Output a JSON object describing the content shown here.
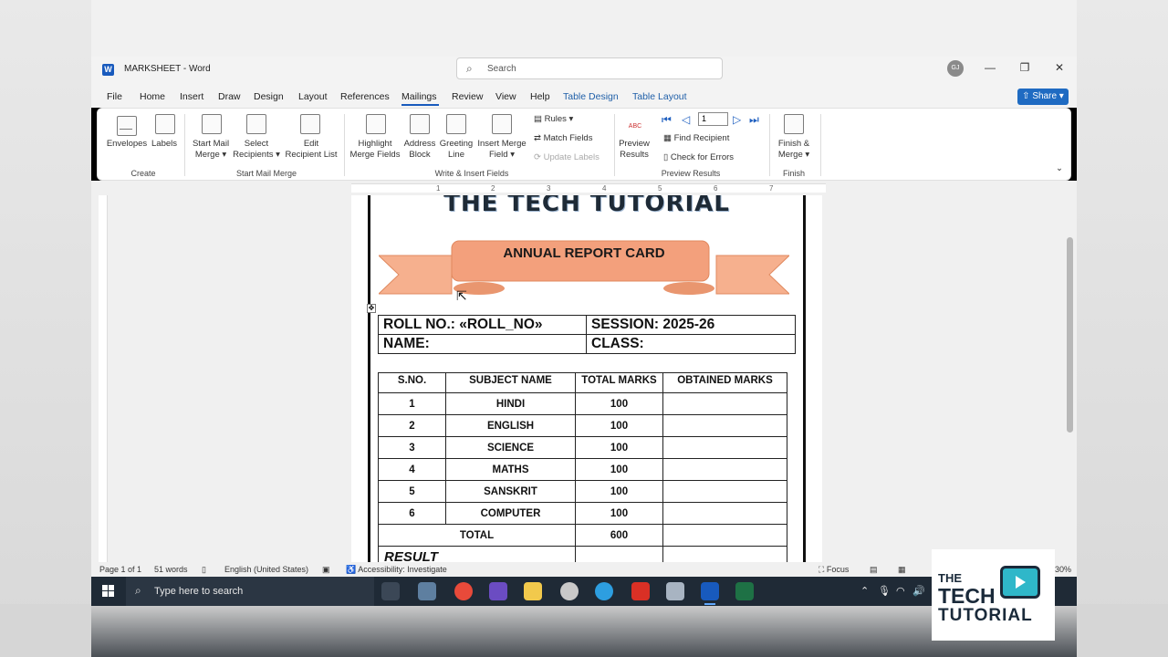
{
  "window": {
    "title": "MARKSHEET  -  Word",
    "search_placeholder": "Search",
    "avatar_initials": "GJ"
  },
  "menu": {
    "items": [
      "File",
      "Home",
      "Insert",
      "Draw",
      "Design",
      "Layout",
      "References",
      "Mailings",
      "Review",
      "View",
      "Help"
    ],
    "context_items": [
      "Table Design",
      "Table Layout"
    ],
    "active": "Mailings",
    "share_label": "Share"
  },
  "ribbon": {
    "create": {
      "envelopes": "Envelopes",
      "labels": "Labels",
      "group": "Create"
    },
    "start_mail_merge": {
      "start_line1": "Start Mail",
      "start_line2": "Merge",
      "select_line1": "Select",
      "select_line2": "Recipients",
      "edit_line1": "Edit",
      "edit_line2": "Recipient List",
      "group": "Start Mail Merge"
    },
    "write_insert": {
      "highlight_line1": "Highlight",
      "highlight_line2": "Merge Fields",
      "address_line1": "Address",
      "address_line2": "Block",
      "greeting_line1": "Greeting",
      "greeting_line2": "Line",
      "insert_line1": "Insert Merge",
      "insert_line2": "Field",
      "rules": "Rules",
      "match_fields": "Match Fields",
      "update_labels": "Update Labels",
      "group": "Write & Insert Fields"
    },
    "preview": {
      "preview_line1": "Preview",
      "preview_line2": "Results",
      "abc_icon_text": "ABC",
      "record": "1",
      "find_recipient": "Find Recipient",
      "check_errors": "Check for Errors",
      "group": "Preview Results"
    },
    "finish": {
      "finish_line1": "Finish &",
      "finish_line2": "Merge",
      "group": "Finish"
    }
  },
  "ruler_numbers": [
    "1",
    "2",
    "3",
    "4",
    "5",
    "6",
    "7"
  ],
  "document": {
    "heading": "THE TECH TUTORIAL",
    "banner": "ANNUAL REPORT CARD",
    "info": {
      "roll": "ROLL NO.: «ROLL_NO»",
      "session": "SESSION: 2025-26",
      "name": "NAME:",
      "class": "CLASS:"
    },
    "marks_table": {
      "headers": [
        "S.NO.",
        "SUBJECT NAME",
        "TOTAL MARKS",
        "OBTAINED MARKS"
      ],
      "rows": [
        [
          "1",
          "HINDI",
          "100",
          ""
        ],
        [
          "2",
          "ENGLISH",
          "100",
          ""
        ],
        [
          "3",
          "SCIENCE",
          "100",
          ""
        ],
        [
          "4",
          "MATHS",
          "100",
          ""
        ],
        [
          "5",
          "SANSKRIT",
          "100",
          ""
        ],
        [
          "6",
          "COMPUTER",
          "100",
          ""
        ]
      ],
      "total_label": "TOTAL",
      "total_value": "600",
      "result_label": "RESULT"
    }
  },
  "status": {
    "page": "Page 1 of 1",
    "words": "51 words",
    "language": "English (United States)",
    "accessibility": "Accessibility: Investigate",
    "focus": "Focus",
    "zoom_suffix": "30%"
  },
  "taskbar": {
    "search_placeholder": "Type here to search"
  },
  "watermark": {
    "line1": "THE",
    "line2": "TECH",
    "line3": "TUTORIAL"
  }
}
